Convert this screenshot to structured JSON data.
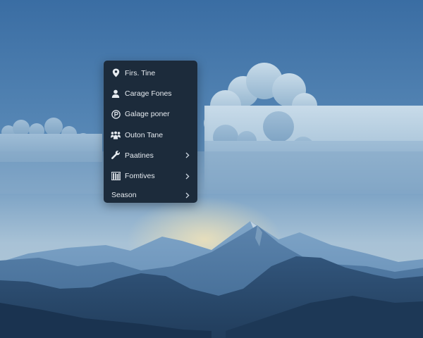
{
  "context_menu": {
    "items": [
      {
        "label": "Firs. Tine",
        "icon": "map-pin-icon",
        "submenu": false
      },
      {
        "label": "Carage Fones",
        "icon": "user-icon",
        "submenu": false
      },
      {
        "label": "Galage poner",
        "icon": "p-circle-icon",
        "submenu": false
      },
      {
        "label": "Outon Tane",
        "icon": "people-icon",
        "submenu": false
      },
      {
        "label": "Paatines",
        "icon": "wrench-icon",
        "submenu": true
      },
      {
        "label": "Fomtives",
        "icon": "books-icon",
        "submenu": true
      },
      {
        "label": "Season",
        "icon": "",
        "submenu": true
      }
    ]
  },
  "colors": {
    "menu_bg": "#1c2b3b",
    "menu_text": "#e6ebf0",
    "sky_top": "#3f72a6",
    "sky_horizon": "#a9c3d8"
  }
}
